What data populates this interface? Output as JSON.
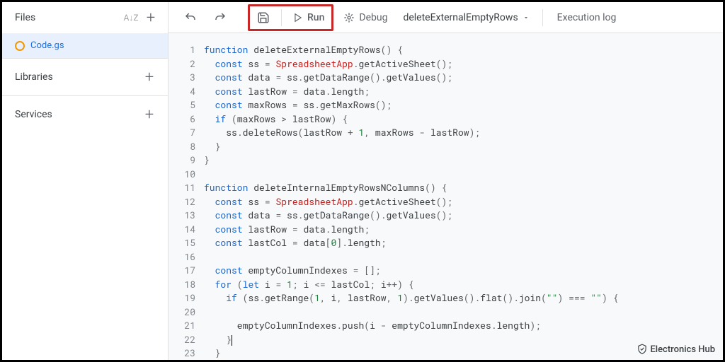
{
  "sidebar": {
    "files_label": "Files",
    "file_name": "Code.gs",
    "libraries_label": "Libraries",
    "services_label": "Services"
  },
  "toolbar": {
    "run_label": "Run",
    "debug_label": "Debug",
    "function_name": "deleteExternalEmptyRows",
    "exec_log_label": "Execution log"
  },
  "code": {
    "lines": 23,
    "f1_name": "deleteExternalEmptyRows",
    "f2_name": "deleteInternalEmptyRowsNColumns",
    "spreadsheetApp": "SpreadsheetApp",
    "getActiveSheet": "getActiveSheet",
    "getDataRange": "getDataRange",
    "getValues": "getValues",
    "getMaxRows": "getMaxRows",
    "deleteRows": "deleteRows",
    "getRange": "getRange",
    "flat": "flat",
    "join": "join",
    "push": "push",
    "const": "const",
    "function": "function",
    "if": "if",
    "for": "for",
    "let": "let",
    "ss": "ss",
    "data": "data",
    "lastRow": "lastRow",
    "maxRows": "maxRows",
    "lastCol": "lastCol",
    "emptyColumnIndexes": "emptyColumnIndexes",
    "length": "length",
    "i": "i",
    "n0": "0",
    "n1": "1",
    "empty_str": "\"\""
  },
  "watermark": "Electronics Hub"
}
